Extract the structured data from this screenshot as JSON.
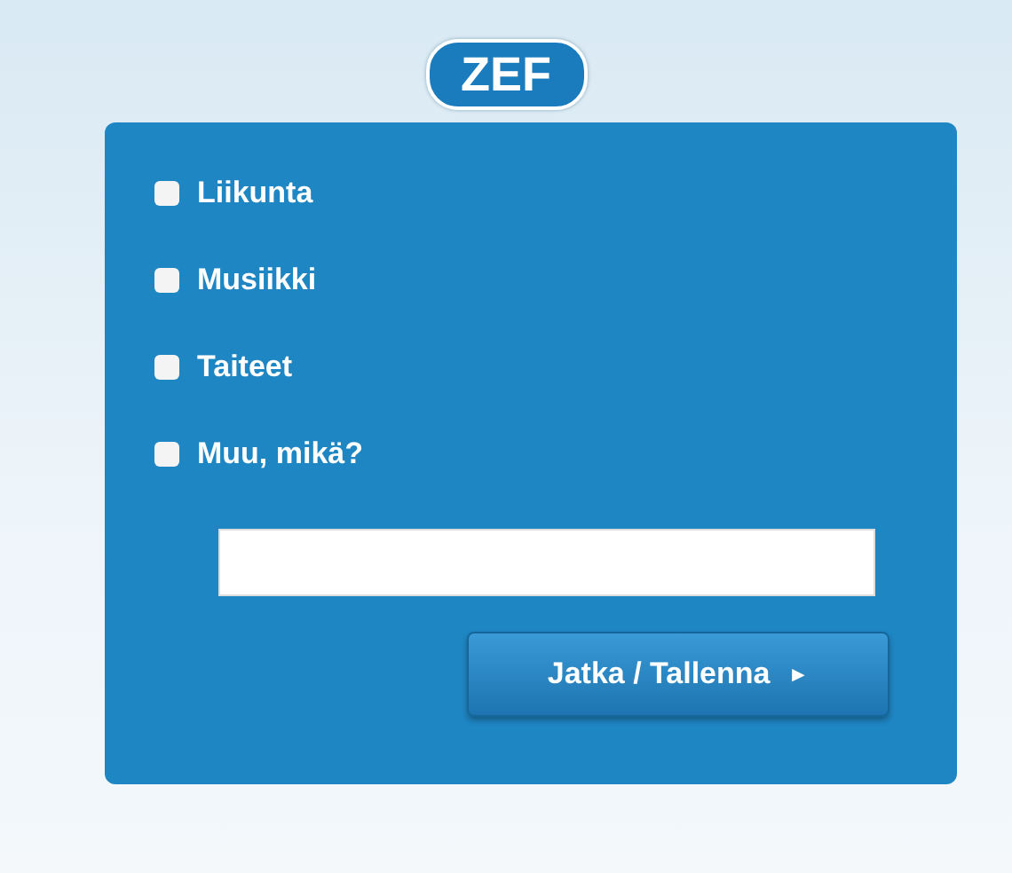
{
  "logo": {
    "text": "ZEF"
  },
  "options": [
    {
      "label": "Liikunta",
      "checked": false
    },
    {
      "label": "Musiikki",
      "checked": false
    },
    {
      "label": "Taiteet",
      "checked": false
    },
    {
      "label": "Muu, mikä?",
      "checked": false
    }
  ],
  "button": {
    "label": "Jatka / Tallenna",
    "arrow": "►"
  }
}
